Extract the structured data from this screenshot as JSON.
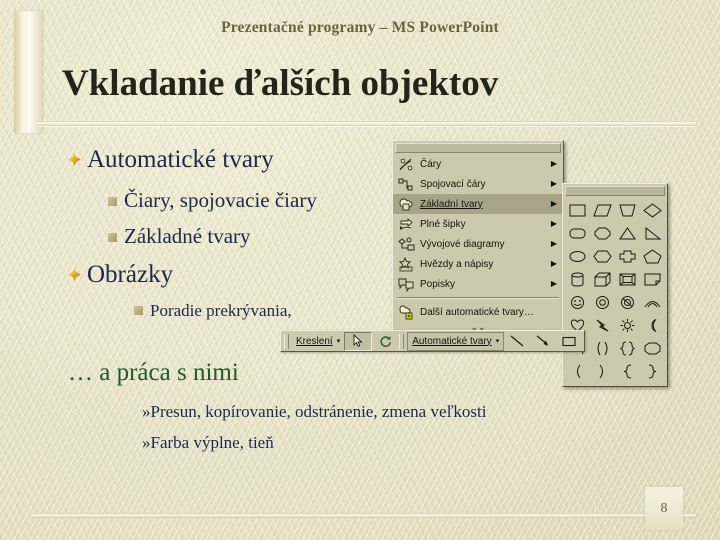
{
  "slide": {
    "header_subtitle": "Prezentačné programy – MS PowerPoint",
    "title": "Vkladanie ďalších objektov",
    "page_number": "8",
    "colors": {
      "background": "#e9e4c9",
      "title_text": "#262418",
      "header_text": "#6b6340",
      "body_text": "#1b2a4a",
      "accent_green": "#1d5b2a",
      "bullet_gold": "#e8b420",
      "bullet_square": "#a79b6c",
      "menu_face": "#cdc9ad",
      "menu_selected": "#a9a488"
    }
  },
  "outline": [
    {
      "level": 1,
      "text": "Automatické tvary",
      "bullet": "gold-diamond-icon"
    },
    {
      "level": 2,
      "text": "Čiary, spojovacie čiary",
      "bullet": "square-bullet-icon"
    },
    {
      "level": 2,
      "text": "Základné tvary",
      "bullet": "square-bullet-icon"
    },
    {
      "level": 1,
      "text": "Obrázky",
      "bullet": "gold-diamond-icon"
    },
    {
      "level": 3,
      "text": "Poradie prekrývania,",
      "bullet": "square-bullet-icon"
    }
  ],
  "section2": {
    "heading": "… a práca s nimi",
    "items": [
      {
        "marker": "»",
        "text": "Presun, kopírovanie, odstránenie, zmena veľkosti"
      },
      {
        "marker": "»",
        "text": "Farba výplne, tieň"
      }
    ]
  },
  "autoshapes_menu": {
    "items": [
      {
        "label": "Čáry",
        "accel": "á",
        "icon": "lines-icon",
        "submenu": true,
        "selected": false
      },
      {
        "label": "Spojovací čáry",
        "accel": "S",
        "icon": "connectors-icon",
        "submenu": true,
        "selected": false
      },
      {
        "label": "Základní tvary",
        "accel": "Z",
        "icon": "basic-shapes-icon",
        "submenu": true,
        "selected": true
      },
      {
        "label": "Plné šipky",
        "accel": "k",
        "icon": "block-arrows-icon",
        "submenu": true,
        "selected": false
      },
      {
        "label": "Vývojové diagramy",
        "accel": "d",
        "icon": "flowchart-icon",
        "submenu": true,
        "selected": false
      },
      {
        "label": "Hvězdy a nápisy",
        "accel": "H",
        "icon": "stars-banners-icon",
        "submenu": true,
        "selected": false
      },
      {
        "label": "Popisky",
        "accel": "P",
        "icon": "callouts-icon",
        "submenu": true,
        "selected": false
      }
    ],
    "more_item": {
      "label": "Další automatické tvary…",
      "accel": "D",
      "icon": "more-autoshapes-icon"
    },
    "expand_indicator": "⌄⌄",
    "submenu_arrow": "▶"
  },
  "shapes_palette": {
    "rows": [
      [
        "rectangle-shape",
        "parallelogram-shape",
        "trapezoid-shape",
        "diamond-shape"
      ],
      [
        "rounded-rectangle-shape",
        "octagon-shape",
        "triangle-shape",
        "right-triangle-shape"
      ],
      [
        "oval-shape",
        "hexagon-shape",
        "cross-shape",
        "pentagon-shape"
      ],
      [
        "cylinder-shape",
        "cube-shape",
        "bevel-shape",
        "folded-corner-shape"
      ],
      [
        "smiley-face-shape",
        "donut-shape",
        "no-symbol-shape",
        "arc-shape"
      ],
      [
        "heart-shape",
        "lightning-bolt-shape",
        "sun-shape",
        "moon-shape"
      ],
      [
        "curve-shape",
        "round-brackets-shape",
        "curly-brackets-shape",
        "regular-pentagon-shape"
      ],
      [
        "left-bracket-shape",
        "right-bracket-shape",
        "left-brace-shape",
        "right-brace-shape"
      ]
    ]
  },
  "drawing_toolbar": {
    "draw_menu": {
      "label": "Kreslení",
      "accel": "K",
      "caret": "▾"
    },
    "select_tool": "select-arrow-icon",
    "rotate_tool": "free-rotate-icon",
    "autoshapes_menu": {
      "label": "Automatické tvary",
      "accel": "u",
      "caret": "▾"
    },
    "line_tool": "line-icon",
    "arrow_tool": "arrow-icon",
    "rectangle_tool": "rectangle-icon"
  }
}
